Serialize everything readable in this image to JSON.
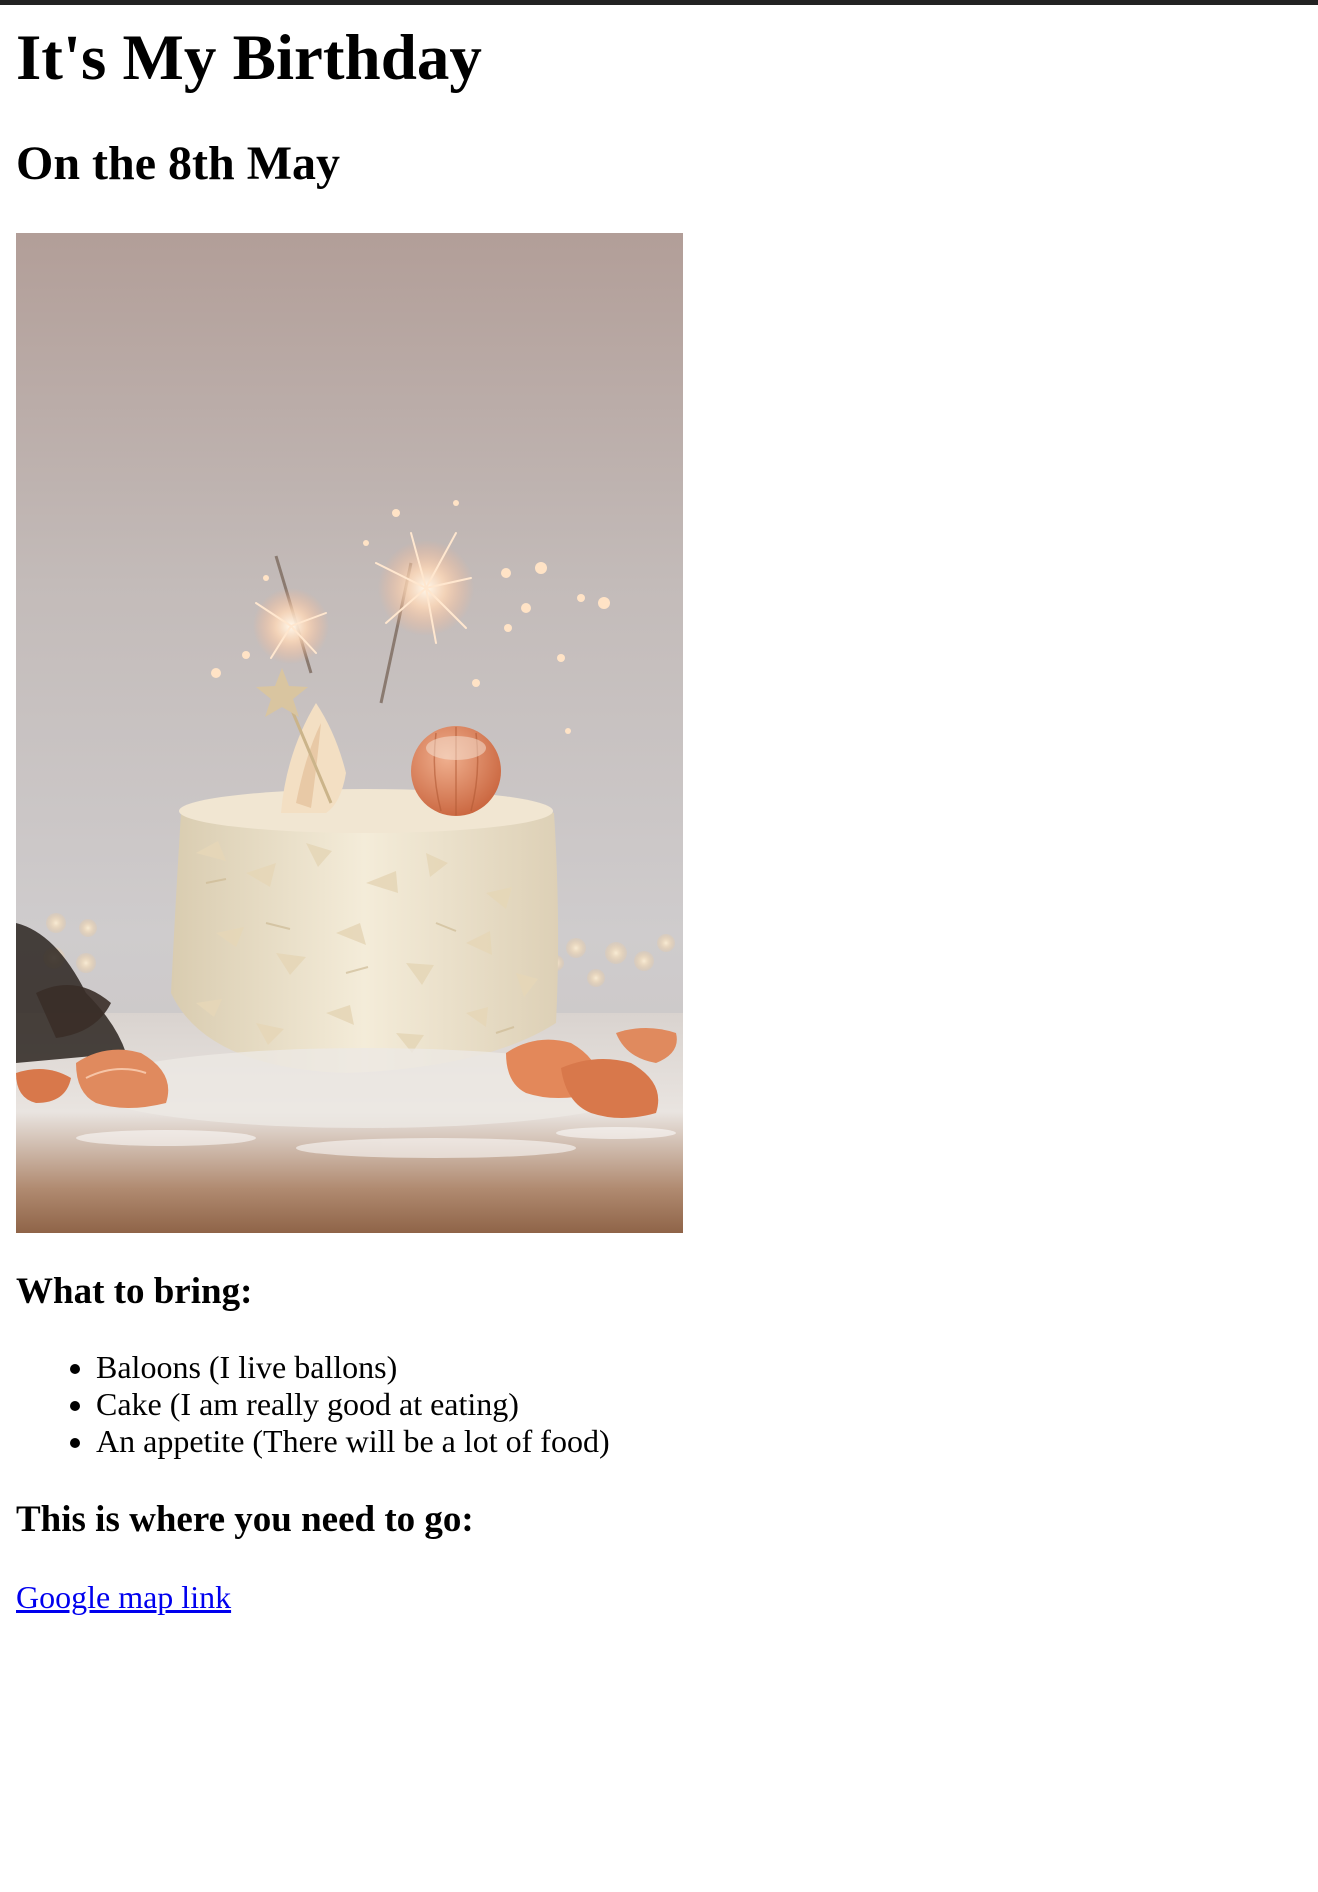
{
  "page": {
    "title": "It's My Birthday",
    "subtitle": "On the 8th May"
  },
  "image": {
    "description_icon": "cake-with-sparklers-photo"
  },
  "bring": {
    "heading": "What to bring:",
    "items": [
      "Baloons (I live ballons)",
      "Cake (I am really good at eating)",
      "An appetite (There will be a lot of food)"
    ]
  },
  "directions": {
    "heading": "This is where you need to go:",
    "link_label": "Google map link"
  },
  "colors": {
    "link": "#0000ee",
    "top_rule": "#222222"
  }
}
